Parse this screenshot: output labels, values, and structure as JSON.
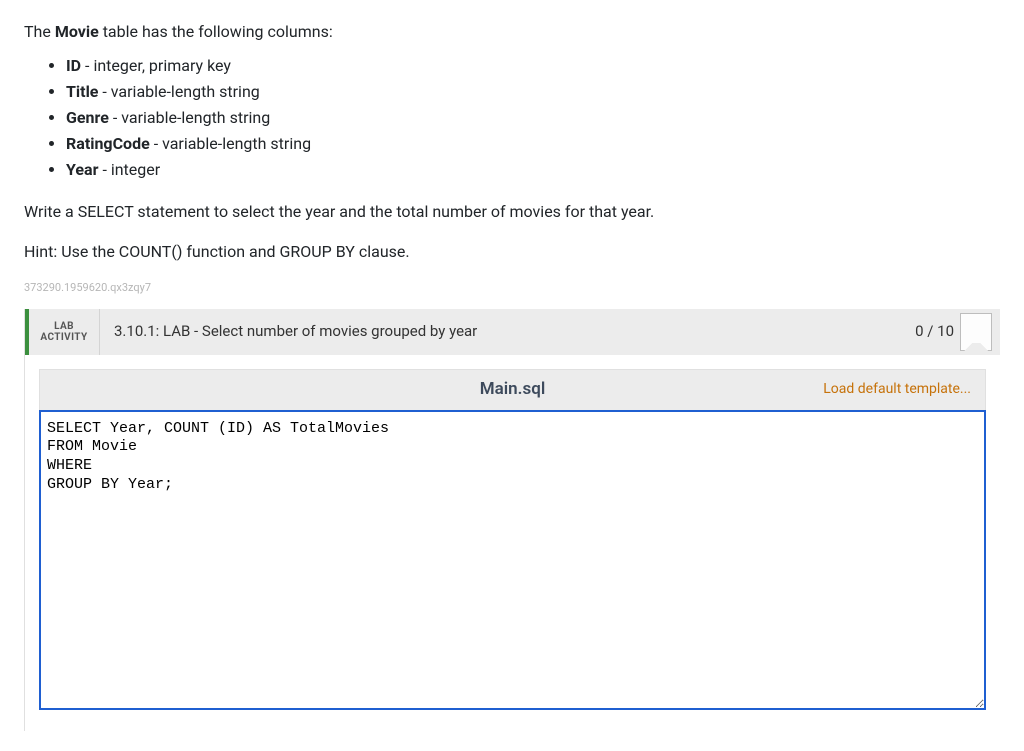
{
  "intro": {
    "sentence_pre": "The ",
    "table_name": "Movie",
    "sentence_post": " table has the following columns:"
  },
  "columns": [
    {
      "name": "ID",
      "desc": " - integer, primary key"
    },
    {
      "name": "Title",
      "desc": " - variable-length string"
    },
    {
      "name": "Genre",
      "desc": " - variable-length string"
    },
    {
      "name": "RatingCode",
      "desc": " - variable-length string"
    },
    {
      "name": "Year",
      "desc": " - integer"
    }
  ],
  "task": "Write a SELECT statement to select the year and the total number of movies for that year.",
  "hint": "Hint: Use the COUNT() function and GROUP BY clause.",
  "code_id": "373290.1959620.qx3zqy7",
  "lab": {
    "tag_line1": "LAB",
    "tag_line2": "ACTIVITY",
    "title": "3.10.1: LAB - Select number of movies grouped by year",
    "score": "0 / 10"
  },
  "editor": {
    "filename": "Main.sql",
    "load_template_label": "Load default template...",
    "code": "SELECT Year, COUNT (ID) AS TotalMovies\nFROM Movie\nWHERE\nGROUP BY Year;"
  }
}
